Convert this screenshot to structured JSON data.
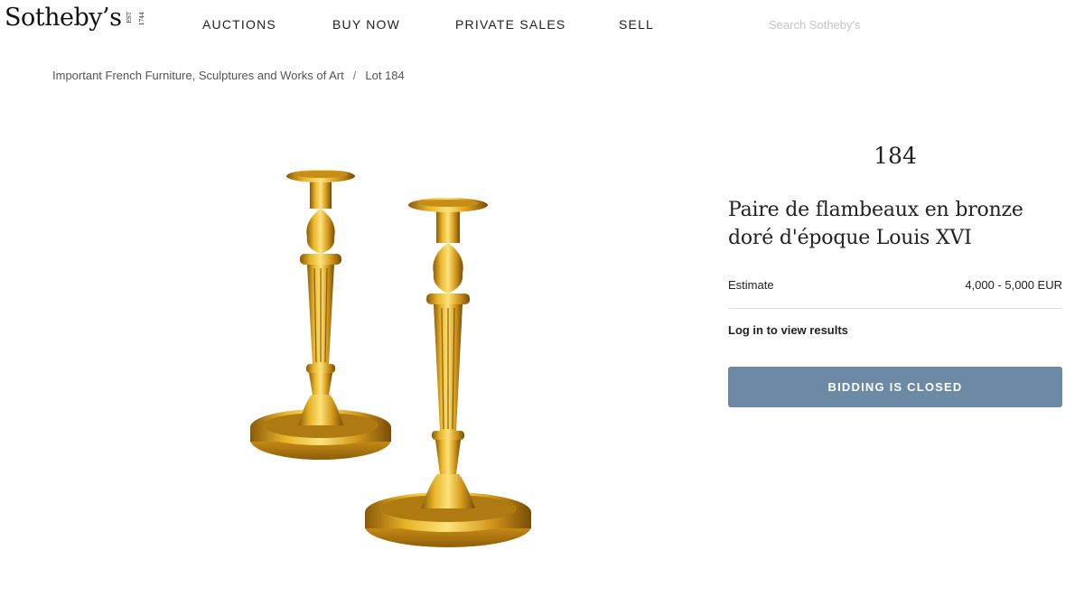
{
  "header": {
    "logo_word": "Sotheby’s",
    "logo_est": [
      "EST",
      "1744"
    ],
    "nav": {
      "auctions": "AUCTIONS",
      "buy_now": "BUY NOW",
      "private_sales": "PRIVATE SALES",
      "sell": "SELL"
    },
    "search_placeholder": "Search Sotheby's"
  },
  "breadcrumb": {
    "sale": "Important French Furniture, Sculptures and Works of Art",
    "separator": "/",
    "lot": "Lot 184"
  },
  "lot": {
    "number": "184",
    "title": "Paire de flambeaux en bronze doré d'époque Louis XVI",
    "estimate_label": "Estimate",
    "estimate_value": "4,000 - 5,000 EUR",
    "login_text": "Log in to view results",
    "bidding_status": "BIDDING IS CLOSED"
  },
  "colors": {
    "button_bg": "#6c8aa6",
    "gilt": "#d4a520"
  }
}
